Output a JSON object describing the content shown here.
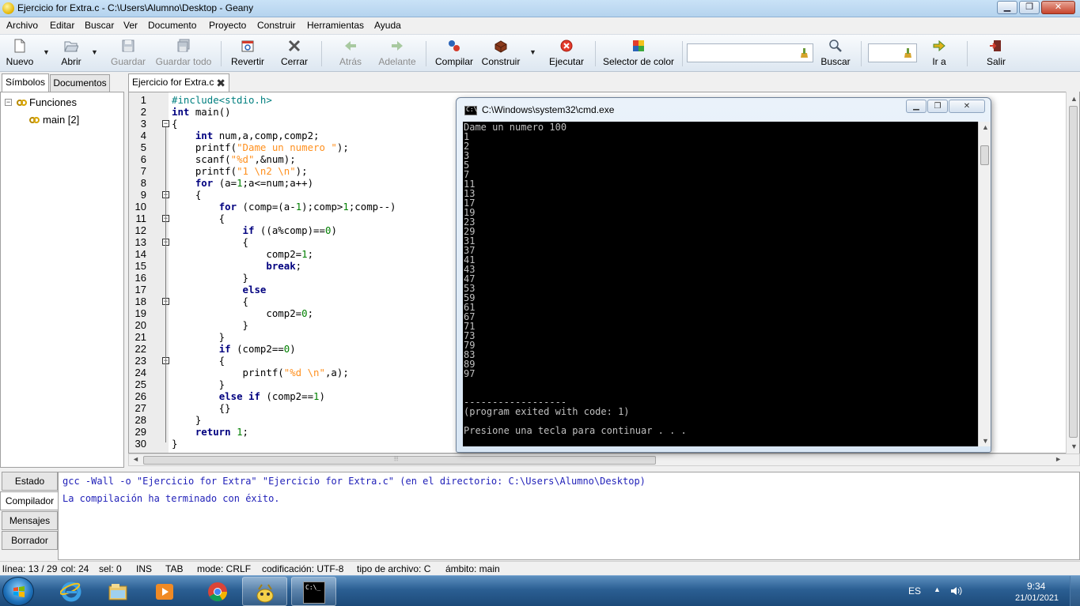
{
  "window": {
    "title": "Ejercicio for Extra.c - C:\\Users\\Alumno\\Desktop - Geany",
    "min_glyph": "▁",
    "max_glyph": "❐",
    "close_glyph": "✕"
  },
  "menu": [
    "Archivo",
    "Editar",
    "Buscar",
    "Ver",
    "Documento",
    "Proyecto",
    "Construir",
    "Herramientas",
    "Ayuda"
  ],
  "toolbar": {
    "new": "Nuevo",
    "open": "Abrir",
    "save": "Guardar",
    "save_all": "Guardar todo",
    "revert": "Revertir",
    "close": "Cerrar",
    "back": "Atrás",
    "forward": "Adelante",
    "compile": "Compilar",
    "build": "Construir",
    "execute": "Ejecutar",
    "color_picker": "Selector de color",
    "search_value": "",
    "search": "Buscar",
    "goto_value": "",
    "goto": "Ir a",
    "quit": "Salir",
    "dropdown_glyph": "▼"
  },
  "sidebar": {
    "tabs": [
      "Símbolos",
      "Documentos"
    ],
    "tree": {
      "expander": "−",
      "group": "Funciones",
      "item": "main [2]"
    }
  },
  "editor": {
    "tab_label": "Ejercicio for Extra.c",
    "tab_close": "✖",
    "lines": [
      {
        "n": "1",
        "t": [
          [
            "pre",
            "#include<stdio.h>"
          ]
        ]
      },
      {
        "n": "2",
        "t": [
          [
            "kw",
            "int"
          ],
          [
            "",
            " main()"
          ]
        ]
      },
      {
        "n": "3",
        "t": [
          [
            "",
            "{"
          ]
        ],
        "fold": "−"
      },
      {
        "n": "4",
        "t": [
          [
            "",
            "    "
          ],
          [
            "kw",
            "int"
          ],
          [
            "",
            " num,a,comp,comp2;"
          ]
        ]
      },
      {
        "n": "5",
        "t": [
          [
            "",
            "    printf("
          ],
          [
            "str",
            "\"Dame un numero \""
          ],
          [
            "",
            ");"
          ]
        ]
      },
      {
        "n": "6",
        "t": [
          [
            "",
            "    scanf("
          ],
          [
            "str",
            "\"%d\""
          ],
          [
            "",
            ",&num);"
          ]
        ]
      },
      {
        "n": "7",
        "t": [
          [
            "",
            "    printf("
          ],
          [
            "str",
            "\"1 \\n2 \\n\""
          ],
          [
            "",
            ");"
          ]
        ]
      },
      {
        "n": "8",
        "t": [
          [
            "",
            "    "
          ],
          [
            "kw",
            "for"
          ],
          [
            "",
            " (a="
          ],
          [
            "num",
            "1"
          ],
          [
            "",
            ";a<=num;a++)"
          ]
        ]
      },
      {
        "n": "9",
        "t": [
          [
            "",
            "    {"
          ]
        ],
        "fold": "−"
      },
      {
        "n": "10",
        "t": [
          [
            "",
            "        "
          ],
          [
            "kw",
            "for"
          ],
          [
            "",
            " (comp=(a-"
          ],
          [
            "num",
            "1"
          ],
          [
            "",
            ");comp>"
          ],
          [
            "num",
            "1"
          ],
          [
            "",
            ";comp--)"
          ]
        ]
      },
      {
        "n": "11",
        "t": [
          [
            "",
            "        {"
          ]
        ],
        "fold": "−"
      },
      {
        "n": "12",
        "t": [
          [
            "",
            "            "
          ],
          [
            "kw",
            "if"
          ],
          [
            "",
            " ((a%comp)=="
          ],
          [
            "num",
            "0"
          ],
          [
            "",
            ")"
          ]
        ]
      },
      {
        "n": "13",
        "t": [
          [
            "",
            "            {"
          ]
        ],
        "fold": "−"
      },
      {
        "n": "14",
        "t": [
          [
            "",
            "                comp2="
          ],
          [
            "num",
            "1"
          ],
          [
            "",
            ";"
          ]
        ]
      },
      {
        "n": "15",
        "t": [
          [
            "",
            "                "
          ],
          [
            "kw",
            "break"
          ],
          [
            "",
            ";"
          ]
        ]
      },
      {
        "n": "16",
        "t": [
          [
            "",
            "            }"
          ]
        ]
      },
      {
        "n": "17",
        "t": [
          [
            "",
            "            "
          ],
          [
            "kw",
            "else"
          ]
        ]
      },
      {
        "n": "18",
        "t": [
          [
            "",
            "            {"
          ]
        ],
        "fold": "−"
      },
      {
        "n": "19",
        "t": [
          [
            "",
            "                comp2="
          ],
          [
            "num",
            "0"
          ],
          [
            "",
            ";"
          ]
        ]
      },
      {
        "n": "20",
        "t": [
          [
            "",
            "            }"
          ]
        ]
      },
      {
        "n": "21",
        "t": [
          [
            "",
            "        }"
          ]
        ]
      },
      {
        "n": "22",
        "t": [
          [
            "",
            "        "
          ],
          [
            "kw",
            "if"
          ],
          [
            "",
            " (comp2=="
          ],
          [
            "num",
            "0"
          ],
          [
            "",
            ")"
          ]
        ]
      },
      {
        "n": "23",
        "t": [
          [
            "",
            "        {"
          ]
        ],
        "fold": "−"
      },
      {
        "n": "24",
        "t": [
          [
            "",
            "            printf("
          ],
          [
            "str",
            "\"%d \\n\""
          ],
          [
            "",
            ",a);"
          ]
        ]
      },
      {
        "n": "25",
        "t": [
          [
            "",
            "        }"
          ]
        ]
      },
      {
        "n": "26",
        "t": [
          [
            "",
            "        "
          ],
          [
            "kw",
            "else if"
          ],
          [
            "",
            " (comp2=="
          ],
          [
            "num",
            "1"
          ],
          [
            "",
            ")"
          ]
        ]
      },
      {
        "n": "27",
        "t": [
          [
            "",
            "        {}"
          ]
        ]
      },
      {
        "n": "28",
        "t": [
          [
            "",
            "    }"
          ]
        ]
      },
      {
        "n": "29",
        "t": [
          [
            "",
            "    "
          ],
          [
            "kw",
            "return"
          ],
          [
            "",
            " "
          ],
          [
            "num",
            "1"
          ],
          [
            "",
            ";"
          ]
        ]
      },
      {
        "n": "30",
        "t": [
          [
            "",
            "}"
          ]
        ]
      }
    ]
  },
  "cmd": {
    "title": "C:\\Windows\\system32\\cmd.exe",
    "icon_text": "C:\\",
    "min_glyph": "▁",
    "max_glyph": "❐",
    "close_glyph": "✕",
    "lines": [
      "Dame un numero 100",
      "1",
      "2",
      "3",
      "5",
      "7",
      "11",
      "13",
      "17",
      "19",
      "23",
      "29",
      "31",
      "37",
      "41",
      "43",
      "47",
      "53",
      "59",
      "61",
      "67",
      "71",
      "73",
      "79",
      "83",
      "89",
      "97",
      "",
      "",
      "------------------",
      "(program exited with code: 1)",
      "",
      "Presione una tecla para continuar . . ."
    ]
  },
  "messages": {
    "tabs": [
      "Estado",
      "Compilador",
      "Mensajes",
      "Borrador"
    ],
    "active_tab": "Compilador",
    "lines": [
      "gcc -Wall -o \"Ejercicio for Extra\" \"Ejercicio for Extra.c\" (en el directorio: C:\\Users\\Alumno\\Desktop)",
      "La compilación ha terminado con éxito."
    ]
  },
  "statusbar": {
    "line": "línea: 13 / 29",
    "col": "col: 24",
    "sel": "sel: 0",
    "ins": "INS",
    "tab": "TAB",
    "mode": "mode: CRLF",
    "encoding": "codificación: UTF-8",
    "filetype": "tipo de archivo: C",
    "scope": "ámbito: main"
  },
  "taskbar": {
    "lang": "ES",
    "tray_up": "▲",
    "time": "9:34",
    "date": "21/01/2021",
    "cmd_icon_text": "C:\\_"
  },
  "scroll": {
    "left": "◄",
    "right": "►",
    "up": "▲",
    "down": "▼",
    "grip": "⦙⦙⦙"
  }
}
